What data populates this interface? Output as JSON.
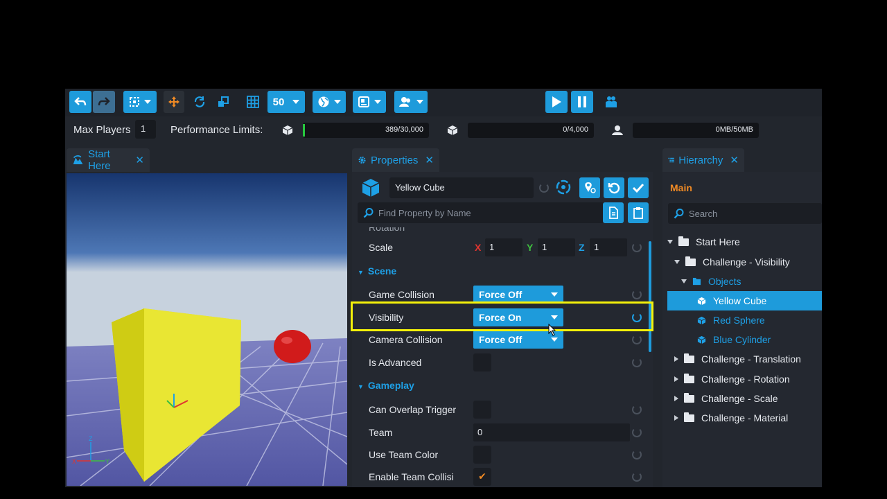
{
  "toolbar": {
    "grid_value": "50"
  },
  "stats": {
    "max_players_label": "Max Players",
    "max_players_value": "1",
    "perf_label": "Performance Limits:",
    "objects_bar": "389/30,000",
    "objects_fraction": 0.013,
    "networked_bar": "0/4,000",
    "memory_bar": "0MB/50MB"
  },
  "viewport": {
    "tab_label": "Start Here",
    "close_glyph": "✕"
  },
  "properties": {
    "tab_label": "Properties",
    "close_glyph": "✕",
    "object_name": "Yellow Cube",
    "search_placeholder": "Find Property by Name",
    "rotation_label": "Rotation",
    "scale_label": "Scale",
    "x_label": "X",
    "y_label": "Y",
    "z_label": "Z",
    "scale_x": "1",
    "scale_y": "1",
    "scale_z": "1",
    "scene_section": "Scene",
    "game_collision_label": "Game Collision",
    "game_collision_value": "Force Off",
    "visibility_label": "Visibility",
    "visibility_value": "Force On",
    "camera_collision_label": "Camera Collision",
    "camera_collision_value": "Force Off",
    "is_advanced_label": "Is Advanced",
    "gameplay_section": "Gameplay",
    "can_overlap_label": "Can Overlap Trigger",
    "team_label": "Team",
    "team_value": "0",
    "use_team_color_label": "Use Team Color",
    "enable_team_collision_label": "Enable Team Collisi",
    "checkmark": "✔"
  },
  "hierarchy": {
    "tab_label": "Hierarchy",
    "close_glyph": "✕",
    "root_label": "Main",
    "search_placeholder": "Search",
    "items": [
      {
        "label": "Start Here"
      },
      {
        "label": "Challenge - Visibility"
      },
      {
        "label": "Objects"
      },
      {
        "label": "Yellow Cube"
      },
      {
        "label": "Red Sphere"
      },
      {
        "label": "Blue Cylinder"
      },
      {
        "label": "Challenge - Translation"
      },
      {
        "label": "Challenge - Rotation"
      },
      {
        "label": "Challenge - Scale"
      },
      {
        "label": "Challenge - Material"
      }
    ]
  },
  "colors": {
    "accent": "#1e9bdb",
    "highlight": "#f5f20a",
    "axis_x": "#e0342f",
    "axis_y": "#3fbf3f",
    "axis_z": "#1ea0e6"
  }
}
